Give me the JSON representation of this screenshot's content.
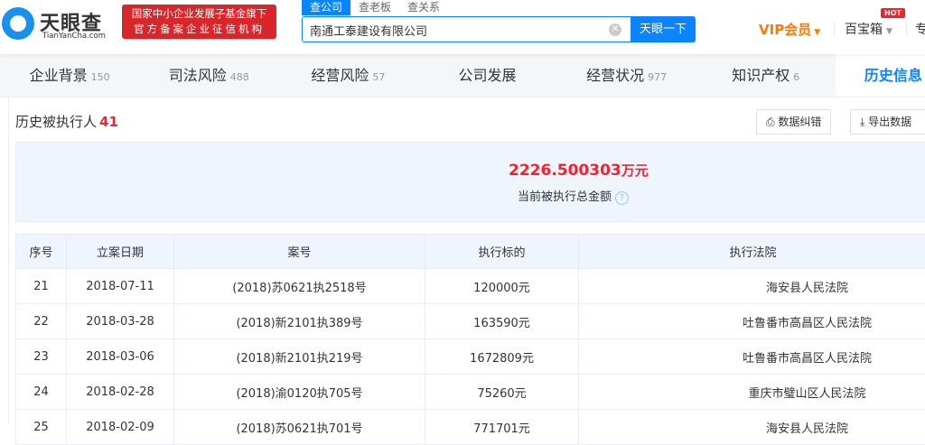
{
  "header": {
    "logo_name": "天眼查",
    "logo_url": "TianYanCha.com",
    "badge_line1": "国家中小企业发展子基金旗下",
    "badge_line2": "官方备案企业征信机构",
    "search_tabs": [
      "查公司",
      "查老板",
      "查关系"
    ],
    "search_value": "南通工泰建设有限公司",
    "search_button": "天眼一下",
    "vip_label": "VIP会员",
    "toolbox_label": "百宝箱",
    "hot_badge": "HOT",
    "more_label": "专"
  },
  "nav": {
    "tabs": [
      {
        "label": "企业背景",
        "count": "150"
      },
      {
        "label": "司法风险",
        "count": "488"
      },
      {
        "label": "经营风险",
        "count": "57"
      },
      {
        "label": "公司发展",
        "count": ""
      },
      {
        "label": "经营状况",
        "count": "977"
      },
      {
        "label": "知识产权",
        "count": "6"
      },
      {
        "label": "历史信息",
        "count": ""
      }
    ]
  },
  "section": {
    "title": "历史被执行人",
    "count": "41",
    "correct_button": "数据纠错",
    "export_button": "导出数据",
    "total_amount": "2226.500303",
    "total_unit": "万元",
    "total_label": "当前被执行总金额"
  },
  "table": {
    "headers": [
      "序号",
      "立案日期",
      "案号",
      "执行标的",
      "执行法院"
    ],
    "rows": [
      [
        "21",
        "2018-07-11",
        "(2018)苏0621执2518号",
        "120000元",
        "海安县人民法院"
      ],
      [
        "22",
        "2018-03-28",
        "(2018)新2101执389号",
        "163590元",
        "吐鲁番市高昌区人民法院"
      ],
      [
        "23",
        "2018-03-06",
        "(2018)新2101执219号",
        "1672809元",
        "吐鲁番市高昌区人民法院"
      ],
      [
        "24",
        "2018-02-28",
        "(2018)渝0120执705号",
        "75260元",
        "重庆市璧山区人民法院"
      ],
      [
        "25",
        "2018-02-09",
        "(2018)苏0621执701号",
        "771701元",
        "海安县人民法院"
      ]
    ]
  },
  "colors": {
    "brand": "#0a84ff",
    "accent_red": "#f5222d",
    "vip": "#ff7a00"
  }
}
